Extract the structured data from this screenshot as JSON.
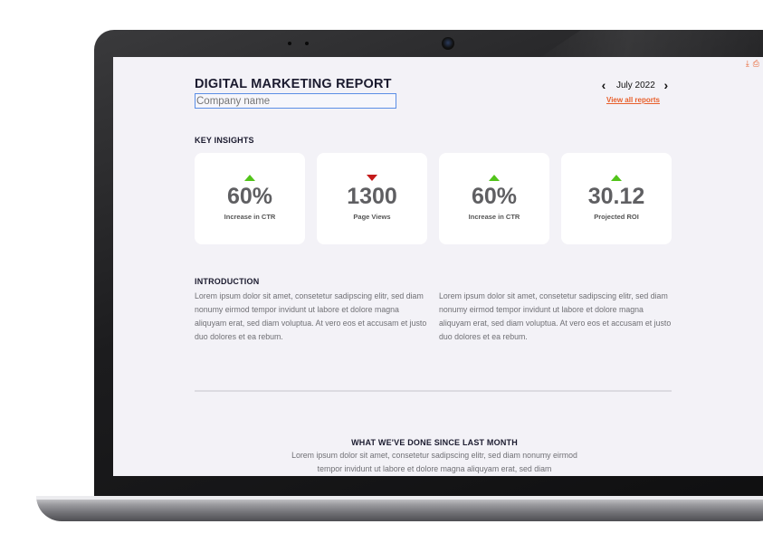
{
  "report": {
    "title": "DIGITAL MARKETING REPORT",
    "company_placeholder": "Company name",
    "month_label": "July 2022",
    "view_all": "View all reports"
  },
  "key_insights": {
    "heading": "KEY INSIGHTS",
    "cards": [
      {
        "value": "60%",
        "label": "Increase in CTR",
        "trend": "up"
      },
      {
        "value": "1300",
        "label": "Page Views",
        "trend": "down"
      },
      {
        "value": "60%",
        "label": "Increase in CTR",
        "trend": "up"
      },
      {
        "value": "30.12",
        "label": "Projected ROI",
        "trend": "up"
      }
    ]
  },
  "introduction": {
    "heading": "INTRODUCTION",
    "col1": "Lorem ipsum dolor sit amet, consetetur sadipscing elitr, sed diam nonumy eirmod tempor invidunt ut labore et dolore magna aliquyam erat, sed diam voluptua. At vero eos et accusam et justo duo dolores et ea rebum.",
    "col2": "Lorem ipsum dolor sit amet, consetetur sadipscing elitr, sed diam nonumy eirmod tempor invidunt ut labore et dolore magna aliquyam erat, sed diam voluptua. At vero eos et accusam et justo duo dolores et ea rebum."
  },
  "since_last_month": {
    "heading": "WHAT WE'VE DONE SINCE LAST MONTH",
    "text": "Lorem ipsum dolor sit amet, consetetur sadipscing elitr, sed diam nonumy eirmod tempor invidunt ut labore et dolore magna aliquyam erat, sed diam"
  },
  "icons": {
    "prev": "‹",
    "next": "›",
    "download": "⤓",
    "print": "⎙"
  },
  "colors": {
    "accent": "#e8602c",
    "trend_up": "#52c41a",
    "trend_down": "#c41a1a",
    "background": "#f3f2f7"
  }
}
